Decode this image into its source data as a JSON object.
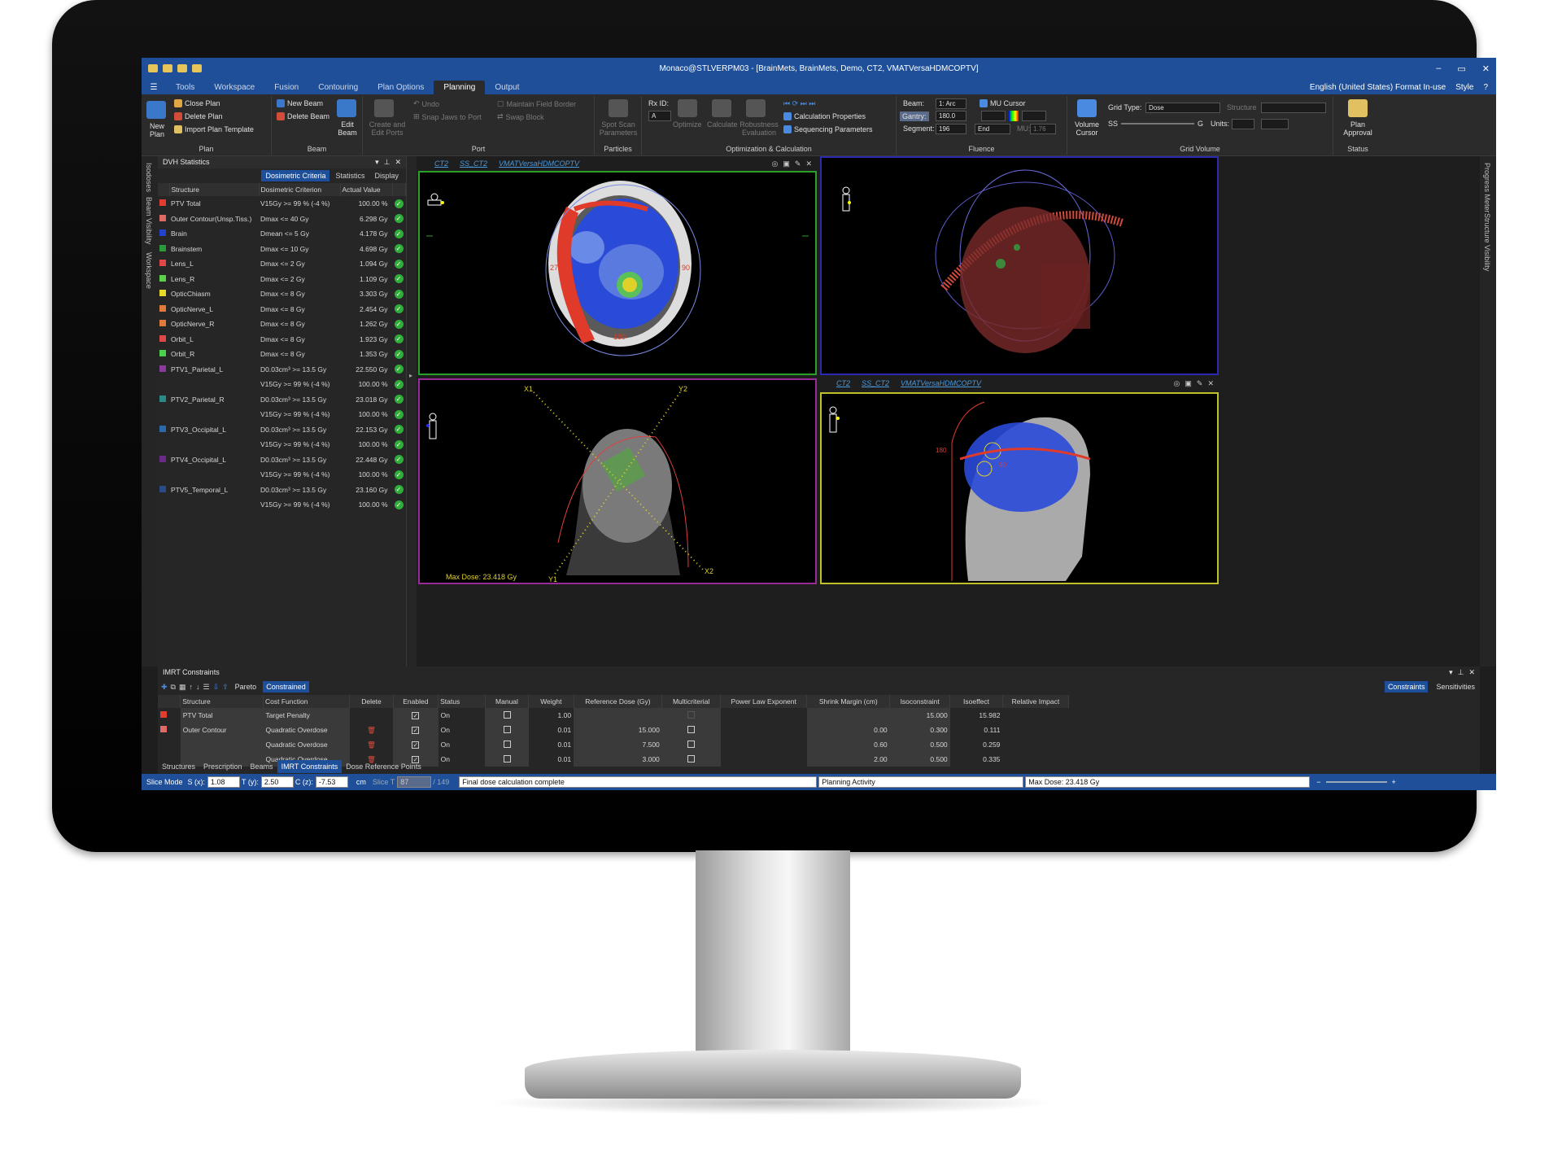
{
  "window": {
    "title": "Monaco@STLVERPM03 - [BrainMets, BrainMets, Demo, CT2, VMATVersaHDMCOPTV]",
    "controls": [
      "–",
      "▭",
      "✕"
    ]
  },
  "menu": {
    "tabs": [
      "Tools",
      "Workspace",
      "Fusion",
      "Contouring",
      "Plan Options",
      "Planning",
      "Output"
    ],
    "active": "Planning",
    "locale": "English (United States) Format In-use",
    "style": "Style"
  },
  "ribbon": {
    "plan": {
      "new_plan": "New Plan",
      "close_plan": "Close Plan",
      "delete_plan": "Delete Plan",
      "import_template": "Import Plan Template",
      "label": "Plan"
    },
    "beam": {
      "new_beam": "New Beam",
      "delete_beam": "Delete Beam",
      "edit_beam": "Edit Beam",
      "label": "Beam"
    },
    "port": {
      "create_edit": "Create and Edit Ports",
      "undo": "Undo",
      "snap": "Snap Jaws to Port",
      "maintain": "Maintain Field Border",
      "swap": "Swap Block",
      "label": "Port"
    },
    "particles": {
      "spot_scan": "Spot Scan Parameters",
      "label": "Particles"
    },
    "opt": {
      "rx_label": "Rx ID:",
      "rx_value": "A",
      "optimize": "Optimize",
      "calculate": "Calculate",
      "robustness": "Robustness Evaluation",
      "calc_props": "Calculation Properties",
      "seq_params": "Sequencing Parameters",
      "label": "Optimization & Calculation"
    },
    "fluence": {
      "beam_label": "Beam:",
      "beam_value": "1: Arc",
      "gantry_label": "Gantry:",
      "gantry_value": "180.0",
      "segment_label": "Segment:",
      "segment_value": "196",
      "end": "End",
      "mu_cursor": "MU Cursor",
      "mu_label": "MU:",
      "mu_value": "1.76",
      "label": "Fluence"
    },
    "grid": {
      "volume_cursor": "Volume Cursor",
      "grid_type_label": "Grid Type:",
      "grid_type": "Dose",
      "structure_label": "Structure",
      "ss": "SS",
      "g": "G",
      "units_label": "Units:",
      "label": "Grid Volume"
    },
    "status": {
      "plan_approval": "Plan Approval",
      "label": "Status"
    }
  },
  "side": {
    "left": [
      "Isodoses",
      "Beam Visibility",
      "Workspace"
    ],
    "right": [
      "Progress Meter",
      "Structure Visibility"
    ]
  },
  "dvh": {
    "title": "DVH Statistics",
    "tabs": [
      "Dosimetric Criteria",
      "Statistics",
      "Display"
    ],
    "active_tab": "Dosimetric Criteria",
    "headers": [
      "Structure",
      "Dosimetric Criterion",
      "Actual Value"
    ],
    "rows": [
      {
        "s": "PTV Total",
        "c": "#e23b2f",
        "crit": "V15Gy >= 99 % (-4 %)",
        "v": "100.00 %"
      },
      {
        "s": "Outer Contour(Unsp.Tiss.)",
        "c": "#e06a66",
        "crit": "Dmax <= 40 Gy",
        "v": "6.298 Gy"
      },
      {
        "s": "Brain",
        "c": "#2244cc",
        "crit": "Dmean <= 5 Gy",
        "v": "4.178 Gy"
      },
      {
        "s": "Brainstem",
        "c": "#2a9a3a",
        "crit": "Dmax <= 10 Gy",
        "v": "4.698 Gy"
      },
      {
        "s": "Lens_L",
        "c": "#e04848",
        "crit": "Dmax <= 2 Gy",
        "v": "1.094 Gy"
      },
      {
        "s": "Lens_R",
        "c": "#5ad14a",
        "crit": "Dmax <= 2 Gy",
        "v": "1.109 Gy"
      },
      {
        "s": "OpticChiasm",
        "c": "#e8d82a",
        "crit": "Dmax <= 8 Gy",
        "v": "3.303 Gy"
      },
      {
        "s": "OpticNerve_L",
        "c": "#e07a3a",
        "crit": "Dmax <= 8 Gy",
        "v": "2.454 Gy"
      },
      {
        "s": "OpticNerve_R",
        "c": "#e07a3a",
        "crit": "Dmax <= 8 Gy",
        "v": "1.262 Gy"
      },
      {
        "s": "Orbit_L",
        "c": "#e04848",
        "crit": "Dmax <= 8 Gy",
        "v": "1.923 Gy"
      },
      {
        "s": "Orbit_R",
        "c": "#4ad04a",
        "crit": "Dmax <= 8 Gy",
        "v": "1.353 Gy"
      },
      {
        "s": "PTV1_Parietal_L",
        "c": "#8a3a9a",
        "crit": "D0.03cm³ >= 13.5 Gy",
        "v": "22.550 Gy"
      },
      {
        "s": "",
        "c": "",
        "crit": "V15Gy >= 99 % (-4 %)",
        "v": "100.00 %"
      },
      {
        "s": "PTV2_Parietal_R",
        "c": "#2a8a8a",
        "crit": "D0.03cm³ >= 13.5 Gy",
        "v": "23.018 Gy"
      },
      {
        "s": "",
        "c": "",
        "crit": "V15Gy >= 99 % (-4 %)",
        "v": "100.00 %"
      },
      {
        "s": "PTV3_Occipital_L",
        "c": "#2a6aaa",
        "crit": "D0.03cm³ >= 13.5 Gy",
        "v": "22.153 Gy"
      },
      {
        "s": "",
        "c": "",
        "crit": "V15Gy >= 99 % (-4 %)",
        "v": "100.00 %"
      },
      {
        "s": "PTV4_Occipital_L",
        "c": "#6a2a8a",
        "crit": "D0.03cm³ >= 13.5 Gy",
        "v": "22.448 Gy"
      },
      {
        "s": "",
        "c": "",
        "crit": "V15Gy >= 99 % (-4 %)",
        "v": "100.00 %"
      },
      {
        "s": "PTV5_Temporal_L",
        "c": "#2a4a8a",
        "crit": "D0.03cm³ >= 13.5 Gy",
        "v": "23.160 Gy"
      },
      {
        "s": "",
        "c": "",
        "crit": "V15Gy >= 99 % (-4 %)",
        "v": "100.00 %"
      }
    ]
  },
  "views": {
    "header_links": [
      "CT2",
      "SS_CT2",
      "VMATVersaHDMCOPTV"
    ],
    "axial": {
      "l270": "270",
      "l90": "90",
      "l180": "180"
    },
    "bev": {
      "x1": "X1",
      "x2": "X2",
      "y1": "Y1",
      "y2": "Y2",
      "max_dose": "Max Dose: 23.418 Gy"
    },
    "sagittal": {
      "l180": "180",
      "l90": "90"
    }
  },
  "imrt": {
    "title": "IMRT Constraints",
    "modes": [
      "Pareto",
      "Constrained"
    ],
    "active_mode": "Constrained",
    "right_tabs": [
      "Constraints",
      "Sensitivities"
    ],
    "active_right": "Constraints",
    "headers": [
      "Structure",
      "Cost Function",
      "Delete",
      "Enabled",
      "Status",
      "Manual",
      "Weight",
      "Reference Dose (Gy)",
      "Multicriterial",
      "Power Law Exponent",
      "Shrink Margin (cm)",
      "Isoconstraint",
      "Isoeffect",
      "Relative Impact"
    ],
    "rows": [
      {
        "s": "PTV Total",
        "c": "#e23b2f",
        "cf": "Target Penalty",
        "status": "On",
        "w": "1.00",
        "ref": "",
        "shrink": "",
        "iso": "15.000",
        "eff": "15.982"
      },
      {
        "s": "Outer Contour",
        "c": "#e06a66",
        "cf": "Quadratic Overdose",
        "status": "On",
        "w": "0.01",
        "ref": "15.000",
        "shrink": "0.00",
        "iso": "0.300",
        "eff": "0.111"
      },
      {
        "s": "",
        "c": "",
        "cf": "Quadratic Overdose",
        "status": "On",
        "w": "0.01",
        "ref": "7.500",
        "shrink": "0.60",
        "iso": "0.500",
        "eff": "0.259"
      },
      {
        "s": "",
        "c": "",
        "cf": "Quadratic Overdose",
        "status": "On",
        "w": "0.01",
        "ref": "3.000",
        "shrink": "2.00",
        "iso": "0.500",
        "eff": "0.335"
      }
    ]
  },
  "bottom_tabs": [
    "Structures",
    "Prescription",
    "Beams",
    "IMRT Constraints",
    "Dose Reference Points"
  ],
  "bottom_active": "IMRT Constraints",
  "statusbar": {
    "mode": "Slice Mode",
    "s_label": "S (x):",
    "s": "1.08",
    "t_label": "T (y):",
    "t": "2.50",
    "c_label": "C (z):",
    "c": "-7.53",
    "unit": "cm",
    "slice_label": "Slice T",
    "slice": "87",
    "slice_total": "/ 149",
    "message": "Final dose calculation complete",
    "activity": "Planning Activity",
    "max_dose": "Max Dose: 23.418 Gy"
  }
}
